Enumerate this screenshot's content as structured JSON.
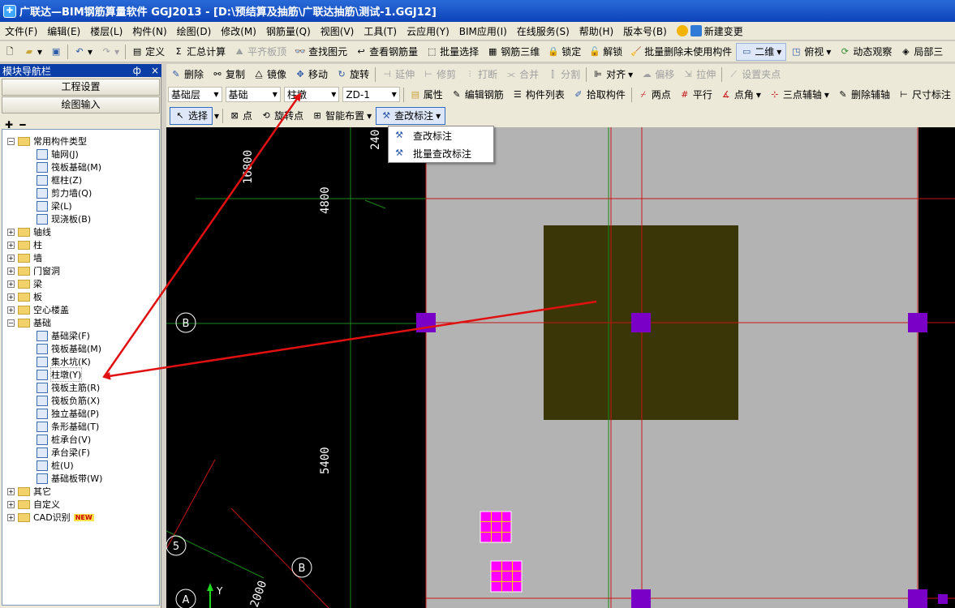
{
  "title": "广联达—BIM钢筋算量软件 GGJ2013 - [D:\\预结算及抽筋\\广联达抽筋\\测试-1.GGJ12]",
  "menu": [
    "文件(F)",
    "编辑(E)",
    "楼层(L)",
    "构件(N)",
    "绘图(D)",
    "修改(M)",
    "钢筋量(Q)",
    "视图(V)",
    "工具(T)",
    "云应用(Y)",
    "BIM应用(I)",
    "在线服务(S)",
    "帮助(H)",
    "版本号(B)",
    "新建变更"
  ],
  "toolbar1": {
    "define": "定义",
    "sum_calc": "汇总计算",
    "flush_slab": "平齐板顶",
    "find_elem": "查找图元",
    "view_rebar": "查看钢筋量",
    "batch_select": "批量选择",
    "rebar_3d": "钢筋三维",
    "lock": "锁定",
    "unlock": "解锁",
    "batch_delete": "批量删除未使用构件",
    "view_2d": "二维",
    "view_top": "俯视",
    "dynamic_view": "动态观察",
    "local": "局部三"
  },
  "nav": {
    "header": "模块导航栏",
    "pin": "ф",
    "close": "×",
    "btn_project": "工程设置",
    "btn_draw": "绘图输入",
    "tools": "✚₊ ━",
    "tree": [
      {
        "label": "常用构件类型",
        "level": 0,
        "type": "folder",
        "exp": "−"
      },
      {
        "label": "轴网(J)",
        "level": 1,
        "type": "leaf"
      },
      {
        "label": "筏板基础(M)",
        "level": 1,
        "type": "leaf"
      },
      {
        "label": "框柱(Z)",
        "level": 1,
        "type": "leaf"
      },
      {
        "label": "剪力墙(Q)",
        "level": 1,
        "type": "leaf"
      },
      {
        "label": "梁(L)",
        "level": 1,
        "type": "leaf"
      },
      {
        "label": "现浇板(B)",
        "level": 1,
        "type": "leaf"
      },
      {
        "label": "轴线",
        "level": 0,
        "type": "folder",
        "exp": "+"
      },
      {
        "label": "柱",
        "level": 0,
        "type": "folder",
        "exp": "+"
      },
      {
        "label": "墙",
        "level": 0,
        "type": "folder",
        "exp": "+"
      },
      {
        "label": "门窗洞",
        "level": 0,
        "type": "folder",
        "exp": "+"
      },
      {
        "label": "梁",
        "level": 0,
        "type": "folder",
        "exp": "+"
      },
      {
        "label": "板",
        "level": 0,
        "type": "folder",
        "exp": "+"
      },
      {
        "label": "空心楼盖",
        "level": 0,
        "type": "folder",
        "exp": "+"
      },
      {
        "label": "基础",
        "level": 0,
        "type": "folder",
        "exp": "−"
      },
      {
        "label": "基础梁(F)",
        "level": 1,
        "type": "leaf"
      },
      {
        "label": "筏板基础(M)",
        "level": 1,
        "type": "leaf"
      },
      {
        "label": "集水坑(K)",
        "level": 1,
        "type": "leaf"
      },
      {
        "label": "柱墩(Y)",
        "level": 1,
        "type": "leaf",
        "selected": true
      },
      {
        "label": "筏板主筋(R)",
        "level": 1,
        "type": "leaf"
      },
      {
        "label": "筏板负筋(X)",
        "level": 1,
        "type": "leaf"
      },
      {
        "label": "独立基础(P)",
        "level": 1,
        "type": "leaf"
      },
      {
        "label": "条形基础(T)",
        "level": 1,
        "type": "leaf"
      },
      {
        "label": "桩承台(V)",
        "level": 1,
        "type": "leaf"
      },
      {
        "label": "承台梁(F)",
        "level": 1,
        "type": "leaf"
      },
      {
        "label": "桩(U)",
        "level": 1,
        "type": "leaf"
      },
      {
        "label": "基础板带(W)",
        "level": 1,
        "type": "leaf"
      },
      {
        "label": "其它",
        "level": 0,
        "type": "folder",
        "exp": "+"
      },
      {
        "label": "自定义",
        "level": 0,
        "type": "folder",
        "exp": "+"
      },
      {
        "label": "CAD识别",
        "level": 0,
        "type": "folder",
        "exp": "+",
        "badge": "NEW"
      }
    ]
  },
  "row1": {
    "delete": "删除",
    "copy": "复制",
    "mirror": "镜像",
    "move": "移动",
    "rotate": "旋转",
    "extend": "延伸",
    "trim": "修剪",
    "break": "打断",
    "merge": "合并",
    "split": "分割",
    "align": "对齐",
    "offset": "偏移",
    "stretch": "拉伸",
    "set_grip": "设置夹点"
  },
  "row2": {
    "layer": "基础层",
    "category": "基础",
    "type": "柱墩",
    "name": "ZD-1",
    "props": "属性",
    "edit_rebar": "编辑钢筋",
    "comp_list": "构件列表",
    "pick": "拾取构件",
    "two_points": "两点",
    "parallel": "平行",
    "point_angle": "点角",
    "three_pt_aux": "三点辅轴",
    "del_aux": "删除辅轴",
    "dim": "尺寸标注"
  },
  "row3": {
    "select": "选择",
    "point": "点",
    "rotate_point": "旋转点",
    "smart_layout": "智能布置",
    "check_label": "查改标注"
  },
  "dropdown": [
    "查改标注",
    "批量查改标注"
  ],
  "canvas": {
    "dims": [
      "16800",
      "4800",
      "5400",
      "240",
      "2000"
    ],
    "axis_b": "B",
    "axis_5": "5",
    "axis_a": "A",
    "y_label": "Y"
  },
  "colors": {
    "title": "#0c43b8",
    "canvas": "#000000",
    "slab": "#b3b3b3",
    "pier": "#3b3608",
    "column": "#7a00c8",
    "arrow": "#e01010",
    "grid": "#1a8a1a",
    "axisline": "#c81414"
  }
}
